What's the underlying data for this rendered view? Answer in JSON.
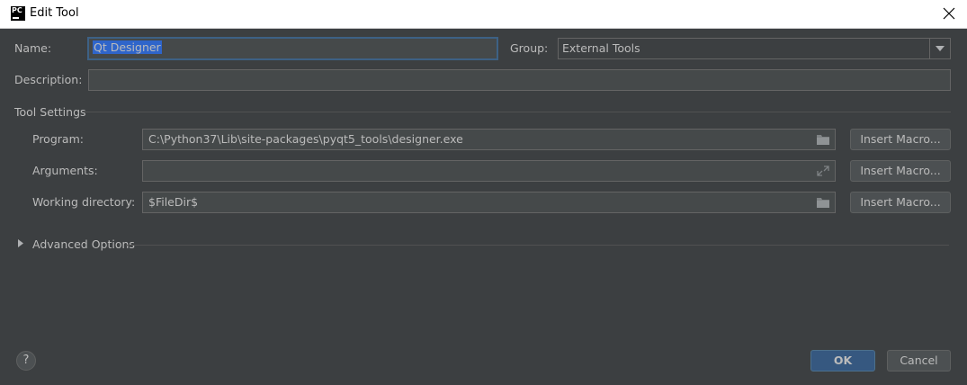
{
  "window": {
    "title": "Edit Tool",
    "app_icon": "pycharm-icon"
  },
  "form": {
    "name_label": "Name:",
    "name_value": "Qt Designer",
    "group_label": "Group:",
    "group_value": "External Tools",
    "description_label": "Description:",
    "description_value": ""
  },
  "tool_settings": {
    "section_label": "Tool Settings",
    "program_label": "Program:",
    "program_value": "C:\\Python37\\Lib\\site-packages\\pyqt5_tools\\designer.exe",
    "arguments_label": "Arguments:",
    "arguments_value": "",
    "working_dir_label": "Working directory:",
    "working_dir_value": "$FileDir$",
    "insert_macro_label": "Insert Macro..."
  },
  "advanced": {
    "label": "Advanced Options"
  },
  "footer": {
    "help_label": "?",
    "ok_label": "OK",
    "cancel_label": "Cancel"
  },
  "colors": {
    "background": "#3c3f41",
    "field_bg": "#45494a",
    "focus_border": "#3d6185",
    "selection": "#2f65ca",
    "primary_button": "#365880"
  }
}
